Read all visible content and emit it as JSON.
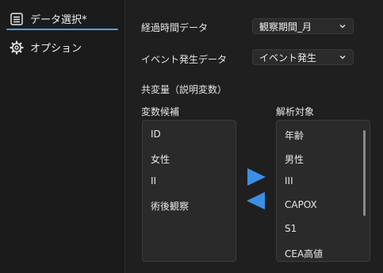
{
  "sidebar": {
    "items": [
      {
        "label": "データ選択*",
        "icon": "list-icon"
      },
      {
        "label": "オプション",
        "icon": "gear-icon"
      }
    ],
    "accent": "#4aa3f0"
  },
  "main": {
    "elapsed": {
      "label": "経過時間データ",
      "value": "観察期間_月"
    },
    "event": {
      "label": "イベント発生データ",
      "value": "イベント発生"
    },
    "covariate_heading": "共変量（説明変数）",
    "candidates": {
      "label": "変数候補",
      "items": [
        "ID",
        "女性",
        "II",
        "術後観察"
      ]
    },
    "targets": {
      "label": "解析対象",
      "items": [
        "年齢",
        "男性",
        "III",
        "CAPOX",
        "S1",
        "CEA高値"
      ]
    },
    "arrow_color": "#3b8fe6"
  }
}
